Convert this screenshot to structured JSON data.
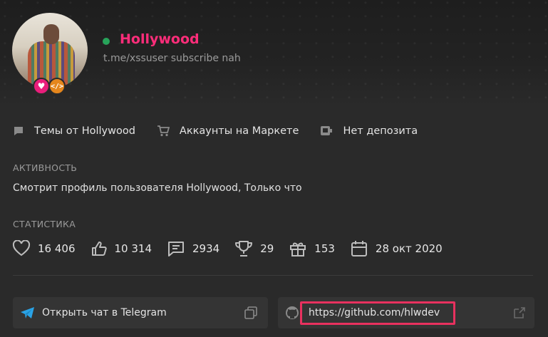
{
  "profile": {
    "username": "Hollywood",
    "status_text": "t.me/xssuser subscribe nah",
    "online": true,
    "username_color": "#ff2d7a",
    "badges": [
      "heart-badge",
      "code-badge"
    ]
  },
  "links": [
    {
      "icon": "comment-icon",
      "label": "Темы от Hollywood"
    },
    {
      "icon": "cart-icon",
      "label": "Аккаунты на Маркете"
    },
    {
      "icon": "deposit-icon",
      "label": "Нет депозита"
    }
  ],
  "activity": {
    "title": "АКТИВНОСТЬ",
    "text": "Смотрит профиль пользователя Hollywood, Только что"
  },
  "stats": {
    "title": "СТАТИСТИКА",
    "items": [
      {
        "icon": "heart-icon",
        "value": "16 406"
      },
      {
        "icon": "thumbs-up-icon",
        "value": "10 314"
      },
      {
        "icon": "message-icon",
        "value": "2934"
      },
      {
        "icon": "trophy-icon",
        "value": "29"
      },
      {
        "icon": "gift-icon",
        "value": "153"
      },
      {
        "icon": "calendar-icon",
        "value": "28 окт 2020"
      }
    ]
  },
  "contacts": {
    "telegram_label": "Открыть чат в Telegram",
    "github_url": "https://github.com/hlwdev"
  },
  "colors": {
    "accent_pink": "#ff2d7a",
    "online_green": "#27a35a",
    "telegram_blue": "#2aa3e6",
    "highlight_red": "#e8315f"
  }
}
